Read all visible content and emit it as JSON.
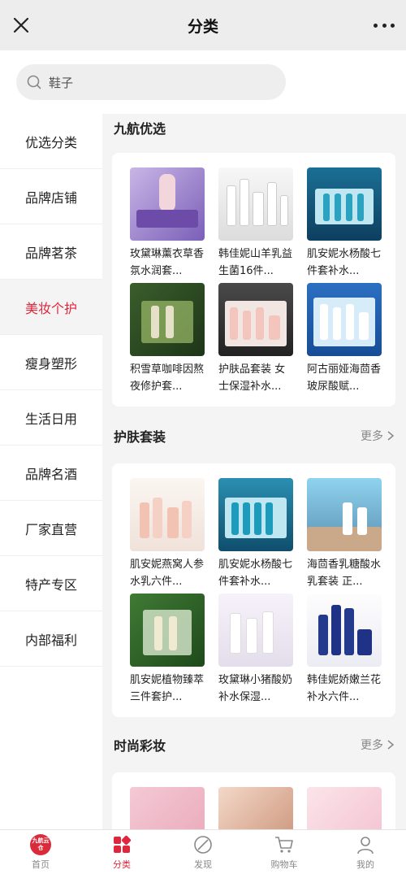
{
  "header": {
    "title": "分类"
  },
  "search": {
    "placeholder": "鞋子"
  },
  "sidebar": {
    "items": [
      {
        "label": "优选分类"
      },
      {
        "label": "品牌店铺"
      },
      {
        "label": "品牌茗茶"
      },
      {
        "label": "美妆个护"
      },
      {
        "label": "瘦身塑形"
      },
      {
        "label": "生活日用"
      },
      {
        "label": "品牌名酒"
      },
      {
        "label": "厂家直营"
      },
      {
        "label": "特产专区"
      },
      {
        "label": "内部福利"
      }
    ],
    "active_index": 3
  },
  "sections": [
    {
      "title": "九航优选",
      "more": "",
      "products": [
        {
          "name": "玫黛琳薰衣草香氛水润套..."
        },
        {
          "name": "韩佳妮山羊乳益生菌16件..."
        },
        {
          "name": "肌安妮水杨酸七件套补水..."
        },
        {
          "name": "积雪草咖啡因熬夜修护套..."
        },
        {
          "name": "护肤品套装 女士保湿补水..."
        },
        {
          "name": "阿古丽娅海茴香玻尿酸赋..."
        }
      ]
    },
    {
      "title": "护肤套装",
      "more": "更多",
      "products": [
        {
          "name": "肌安妮燕窝人参水乳六件..."
        },
        {
          "name": "肌安妮水杨酸七件套补水..."
        },
        {
          "name": "海茴香乳糖酸水乳套装 正..."
        },
        {
          "name": "肌安妮植物臻萃三件套护..."
        },
        {
          "name": "玫黛琳小猪酸奶补水保湿..."
        },
        {
          "name": "韩佳妮娇嫩兰花补水六件..."
        }
      ]
    },
    {
      "title": "时尚彩妆",
      "more": "更多",
      "products": []
    }
  ],
  "tabbar": {
    "logo_text": "九航云仓",
    "items": [
      {
        "label": "首页",
        "icon": "home-logo-icon"
      },
      {
        "label": "分类",
        "icon": "category-icon"
      },
      {
        "label": "发现",
        "icon": "discover-icon"
      },
      {
        "label": "购物车",
        "icon": "cart-icon"
      },
      {
        "label": "我的",
        "icon": "profile-icon"
      }
    ],
    "active_index": 1
  },
  "colors": {
    "accent": "#e0263c",
    "background": "#f4f4f4"
  }
}
